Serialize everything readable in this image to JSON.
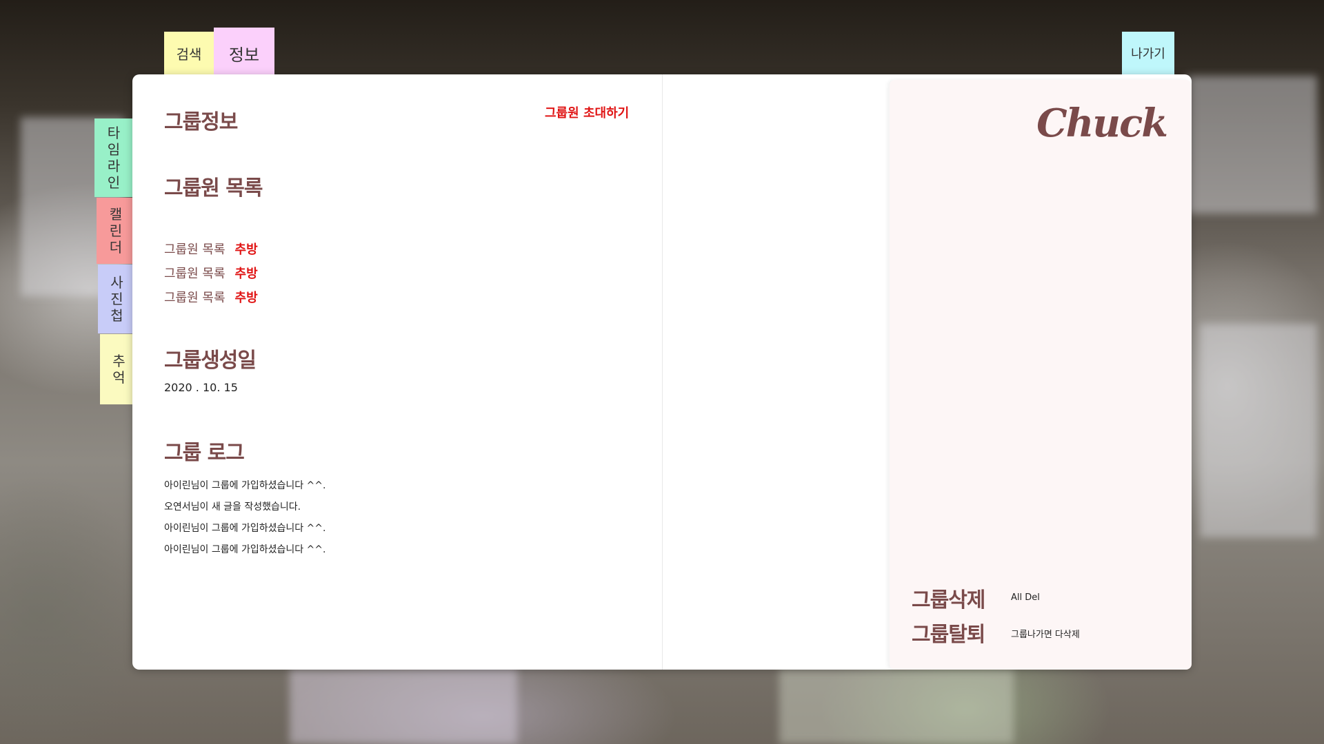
{
  "top_tabs": {
    "search": {
      "label": "검색",
      "color": "#fdfbb0"
    },
    "info": {
      "label": "정보",
      "color": "#fbd0fb"
    },
    "exit": {
      "label": "나가기",
      "color": "#bff7fb"
    }
  },
  "side_tabs": [
    {
      "chars": [
        "타",
        "임",
        "라",
        "인"
      ],
      "color": "#98f0c8"
    },
    {
      "chars": [
        "캘",
        "린",
        "더"
      ],
      "color": "#f79a9a"
    },
    {
      "chars": [
        "사",
        "진",
        "첩"
      ],
      "color": "#c8ccf8"
    },
    {
      "chars": [
        "추",
        "억"
      ],
      "color": "#fbfac0"
    }
  ],
  "left_page": {
    "group_info_title": "그룹정보",
    "invite_label": "그룹원 초대하기",
    "member_list_title": "그룹원 목록",
    "members": [
      {
        "name": "그룹원 목록",
        "action": "추방"
      },
      {
        "name": "그룹원 목록",
        "action": "추방"
      },
      {
        "name": "그룹원 목록",
        "action": "추방"
      }
    ],
    "created_title": "그룹생성일",
    "created_date": "2020 . 10. 15",
    "log_title": "그룹 로그",
    "logs": [
      "아이린님이 그룹에 가입하셨습니다 ^^.",
      "오연서님이 새 글을 작성했습니다.",
      "아이린님이 그룹에 가입하셨습니다 ^^.",
      "아이린님이 그룹에 가입하셨습니다 ^^."
    ]
  },
  "right_panel": {
    "logo": "Chuck",
    "delete_title": "그룹삭제",
    "delete_desc": "All Del",
    "leave_title": "그룹탈퇴",
    "leave_desc": "그룹나가면 다삭제"
  },
  "colors": {
    "accent_brown": "#7a4a4a",
    "danger_red": "#e01414",
    "panel_bg": "#fdf6f6"
  }
}
